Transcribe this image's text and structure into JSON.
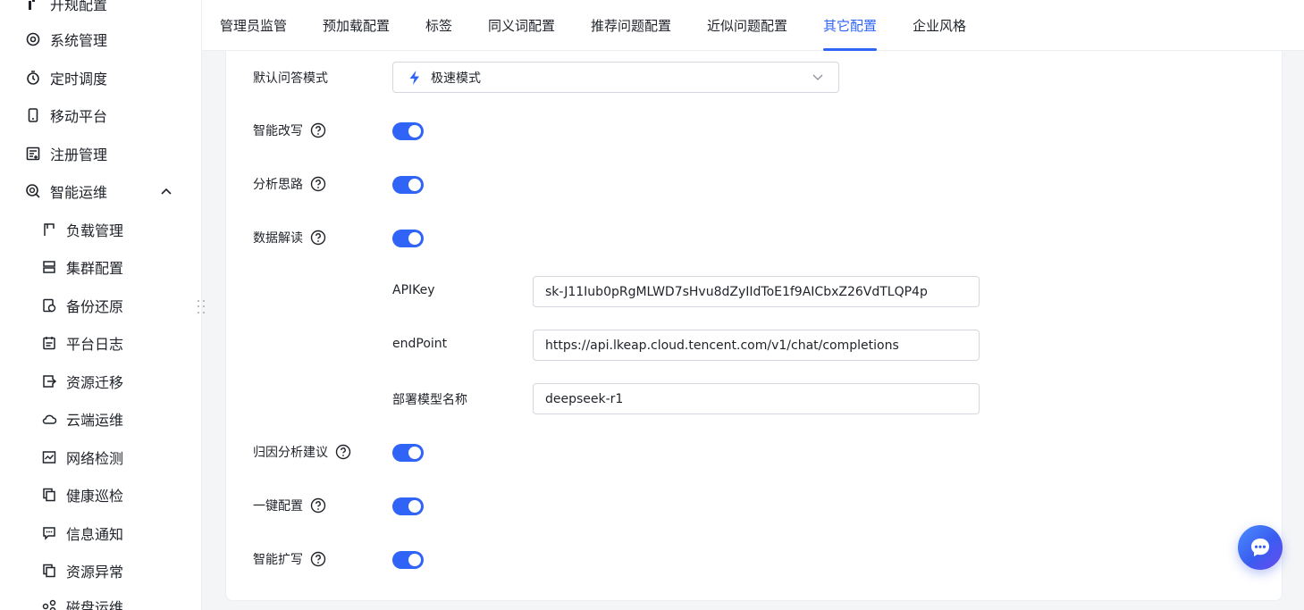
{
  "sidebar": {
    "items": [
      {
        "label": "开规配置",
        "icon": "config-icon"
      },
      {
        "label": "系统管理",
        "icon": "gear-icon"
      },
      {
        "label": "定时调度",
        "icon": "timer-icon"
      },
      {
        "label": "移动平台",
        "icon": "mobile-icon"
      },
      {
        "label": "注册管理",
        "icon": "register-icon"
      },
      {
        "label": "智能运维",
        "icon": "smart-ops-icon",
        "expanded": true
      }
    ],
    "sub_items": [
      {
        "label": "负载管理",
        "icon": "load-icon"
      },
      {
        "label": "集群配置",
        "icon": "cluster-icon"
      },
      {
        "label": "备份还原",
        "icon": "backup-icon"
      },
      {
        "label": "平台日志",
        "icon": "log-icon"
      },
      {
        "label": "资源迁移",
        "icon": "migrate-icon"
      },
      {
        "label": "云端运维",
        "icon": "cloud-icon"
      },
      {
        "label": "网络检测",
        "icon": "network-icon"
      },
      {
        "label": "健康巡检",
        "icon": "health-icon"
      },
      {
        "label": "信息通知",
        "icon": "message-icon"
      },
      {
        "label": "资源异常",
        "icon": "alert-icon"
      },
      {
        "label": "磁盘运维",
        "icon": "disk-icon"
      }
    ]
  },
  "tabs": [
    {
      "label": "管理员监管"
    },
    {
      "label": "预加载配置"
    },
    {
      "label": "标签"
    },
    {
      "label": "同义词配置"
    },
    {
      "label": "推荐问题配置"
    },
    {
      "label": "近似问题配置"
    },
    {
      "label": "其它配置",
      "active": true
    },
    {
      "label": "企业风格"
    }
  ],
  "form": {
    "qa_mode": {
      "label": "默认问答模式",
      "value": "极速模式"
    },
    "smart_rewrite": {
      "label": "智能改写",
      "enabled": true
    },
    "analysis_thinking": {
      "label": "分析思路",
      "enabled": true
    },
    "data_interpretation": {
      "label": "数据解读",
      "enabled": true
    },
    "api_key": {
      "label": "APIKey",
      "value": "sk-J11Iub0pRgMLWD7sHvu8dZyIIdToE1f9AICbxZ26VdTLQP4p"
    },
    "endpoint": {
      "label": "endPoint",
      "value": "https://api.lkeap.cloud.tencent.com/v1/chat/completions"
    },
    "model_name": {
      "label": "部署模型名称",
      "value": "deepseek-r1"
    },
    "attribution_advice": {
      "label": "归因分析建议",
      "enabled": true
    },
    "one_click_config": {
      "label": "一键配置",
      "enabled": true
    },
    "smart_expand": {
      "label": "智能扩写",
      "enabled": true
    }
  },
  "colors": {
    "accent": "#2f64f6",
    "border": "#d4d8de",
    "background": "#f4f5f7"
  }
}
